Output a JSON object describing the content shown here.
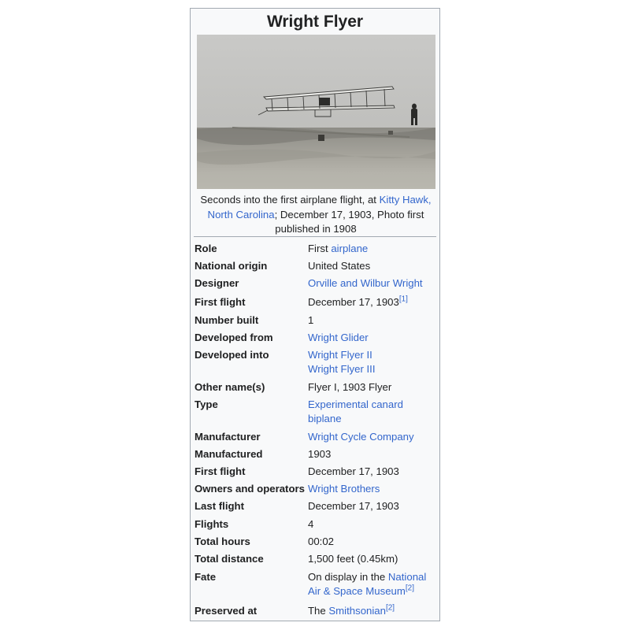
{
  "title": "Wright Flyer",
  "image": {
    "alt": "Photograph of the Wright Flyer in flight over the sand"
  },
  "caption": {
    "pre": "Seconds into the first airplane flight, at ",
    "link": "Kitty Hawk, North Carolina",
    "post": "; December 17, 1903, Photo first published in 1908"
  },
  "rows": {
    "role": {
      "label": "Role",
      "pre": "First ",
      "link": "airplane"
    },
    "national_origin": {
      "label": "National origin",
      "value": "United States"
    },
    "designer": {
      "label": "Designer",
      "link": "Orville and Wilbur Wright"
    },
    "first_flight_1": {
      "label": "First flight",
      "value": "December 17, 1903",
      "ref": "[1]"
    },
    "number_built": {
      "label": "Number built",
      "value": "1"
    },
    "developed_from": {
      "label": "Developed from",
      "link": "Wright Glider"
    },
    "developed_into": {
      "label": "Developed into",
      "link1": "Wright Flyer II",
      "link2": "Wright Flyer III"
    },
    "other_names": {
      "label": "Other name(s)",
      "value": "Flyer I, 1903 Flyer"
    },
    "type": {
      "label": "Type",
      "link": "Experimental canard biplane"
    },
    "manufacturer": {
      "label": "Manufacturer",
      "link": "Wright Cycle Company"
    },
    "manufactured": {
      "label": "Manufactured",
      "value": "1903"
    },
    "first_flight_2": {
      "label": "First flight",
      "value": "December 17, 1903"
    },
    "owners": {
      "label": "Owners and operators",
      "link": "Wright Brothers"
    },
    "last_flight": {
      "label": "Last flight",
      "value": "December 17, 1903"
    },
    "flights": {
      "label": "Flights",
      "value": "4"
    },
    "total_hours": {
      "label": "Total hours",
      "value": "00:02"
    },
    "total_distance": {
      "label": "Total distance",
      "value": "1,500 feet (0.45km)"
    },
    "fate": {
      "label": "Fate",
      "pre": "On display in the ",
      "link": "National Air & Space Museum",
      "ref": "[2]"
    },
    "preserved_at": {
      "label": "Preserved at",
      "pre": "The ",
      "link": "Smithsonian",
      "ref": "[2]"
    }
  }
}
